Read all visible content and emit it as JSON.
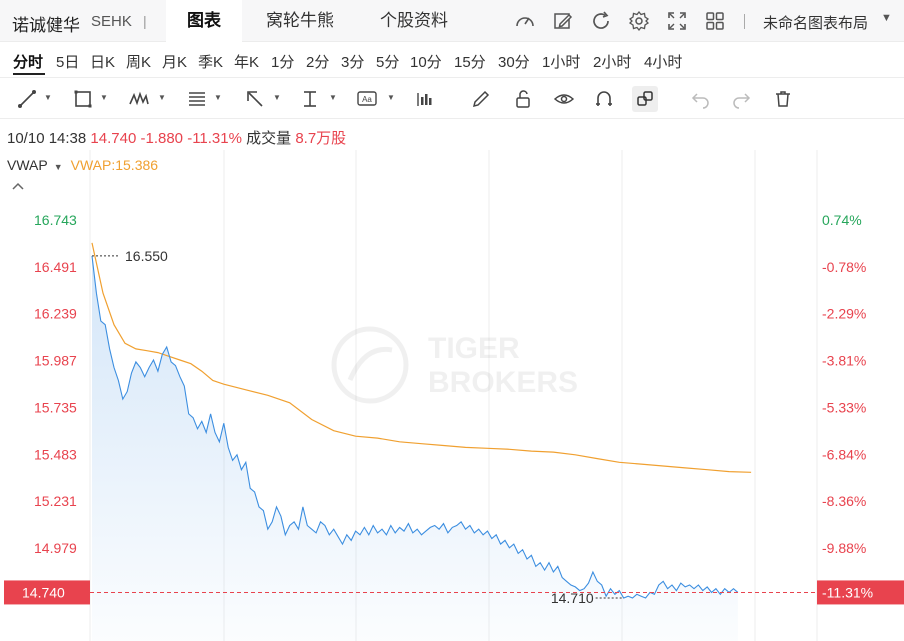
{
  "header": {
    "stock_name": "诺诚健华",
    "market": "SEHK",
    "separator": "|",
    "tabs": [
      {
        "label": "图表",
        "active": true
      },
      {
        "label": "窝轮牛熊",
        "active": false
      },
      {
        "label": "个股资料",
        "active": false
      }
    ],
    "icons": [
      "gauge-icon",
      "pen-edit-icon",
      "refresh-icon",
      "gear-icon",
      "fullscreen-icon",
      "grid-layout-icon"
    ],
    "layout_label": "未命名图表布局",
    "layout_caret": "▼"
  },
  "periods": {
    "items": [
      "分时",
      "5日",
      "日K",
      "周K",
      "月K",
      "季K",
      "年K",
      "1分",
      "2分",
      "3分",
      "5分",
      "10分",
      "15分",
      "30分",
      "1小时",
      "2小时",
      "4小时"
    ],
    "active_index": 0
  },
  "tools": {
    "icons": [
      "trend-line-icon",
      "rectangle-icon",
      "wave-pattern-icon",
      "fib-lines-icon",
      "arrow-icon",
      "measure-icon",
      "text-label-icon",
      "bar-chart-icon",
      "pencil-icon",
      "unlock-icon",
      "eye-icon",
      "magnet-icon",
      "link-icon",
      "undo-icon",
      "redo-icon",
      "trash-icon"
    ]
  },
  "info": {
    "datetime": "10/10 14:38",
    "price": "14.740",
    "change": "-1.880",
    "change_pct": "-11.31%",
    "volume_label": "成交量",
    "volume": "8.7万股"
  },
  "vwap": {
    "name": "VWAP",
    "caret": "▼",
    "value_label": "VWAP:15.386"
  },
  "watermark": {
    "line1": "TIGER",
    "line2": "BROKERS"
  },
  "colors": {
    "up": "#26a65b",
    "down": "#e8434e",
    "price_line": "#3c8ee0",
    "vwap_line": "#f0a030",
    "last_price_tag": "#e8434e"
  },
  "chart_data": {
    "type": "line",
    "prev_close": 16.62,
    "last_price": 14.74,
    "high_marker": "16.550",
    "low_marker": "14.710",
    "price_tag": "14.740",
    "pct_tag": "-11.31%",
    "yticks_left": [
      "16.743",
      "16.491",
      "16.239",
      "15.987",
      "15.735",
      "15.483",
      "15.231",
      "14.979"
    ],
    "yticks_right": [
      "0.74%",
      "-0.78%",
      "-2.29%",
      "-3.81%",
      "-5.33%",
      "-6.84%",
      "-8.36%",
      "-9.88%"
    ],
    "ylim": [
      14.62,
      16.83
    ],
    "x_total_minutes": 330,
    "series": [
      {
        "name": "price",
        "x": [
          0,
          2,
          4,
          6,
          8,
          10,
          12,
          14,
          16,
          18,
          20,
          22,
          24,
          26,
          28,
          30,
          32,
          34,
          36,
          38,
          40,
          42,
          44,
          46,
          48,
          50,
          52,
          54,
          56,
          58,
          60,
          62,
          64,
          66,
          68,
          70,
          72,
          74,
          76,
          78,
          80,
          82,
          84,
          86,
          88,
          90,
          92,
          94,
          96,
          98,
          100,
          102,
          104,
          106,
          108,
          110,
          112,
          114,
          116,
          118,
          120,
          122,
          124,
          126,
          128,
          130,
          132,
          134,
          136,
          138,
          140,
          142,
          144,
          146,
          148,
          150,
          152,
          154,
          156,
          158,
          160,
          162,
          164,
          166,
          168,
          170,
          172,
          174,
          176,
          178,
          180,
          182,
          184,
          186,
          188,
          190,
          192,
          194,
          196,
          198,
          200,
          202,
          204,
          206,
          208,
          210,
          212,
          214,
          216,
          218,
          220,
          222,
          224,
          226,
          228,
          230,
          232,
          234,
          236,
          238,
          240,
          242,
          244,
          246,
          248,
          250,
          252,
          254,
          256,
          258,
          260,
          262,
          264,
          266,
          268,
          270,
          272,
          274,
          276,
          278,
          280,
          282,
          284,
          286,
          288,
          290,
          292,
          294
        ],
        "values": [
          16.55,
          16.35,
          16.2,
          16.18,
          16.05,
          15.95,
          15.88,
          15.78,
          15.82,
          15.92,
          15.98,
          15.95,
          15.9,
          15.95,
          15.99,
          15.93,
          16.02,
          16.06,
          15.98,
          15.96,
          15.9,
          15.85,
          15.7,
          15.68,
          15.62,
          15.66,
          15.6,
          15.7,
          15.6,
          15.55,
          15.65,
          15.52,
          15.45,
          15.48,
          15.4,
          15.44,
          15.3,
          15.28,
          15.2,
          15.18,
          15.08,
          15.12,
          15.2,
          15.15,
          15.05,
          15.1,
          15.12,
          15.08,
          15.2,
          15.1,
          15.08,
          15.06,
          15.12,
          15.1,
          15.05,
          15.08,
          15.04,
          15.0,
          15.05,
          15.02,
          15.07,
          15.05,
          15.09,
          15.05,
          15.1,
          15.06,
          15.08,
          15.05,
          15.1,
          15.06,
          15.09,
          15.07,
          15.11,
          15.06,
          15.08,
          15.05,
          15.07,
          15.09,
          15.1,
          15.08,
          15.11,
          15.06,
          15.09,
          15.1,
          15.12,
          15.08,
          15.1,
          15.06,
          15.08,
          15.05,
          15.07,
          15.03,
          15.05,
          15.0,
          15.02,
          14.98,
          15.0,
          14.95,
          14.97,
          14.92,
          14.94,
          14.88,
          14.9,
          14.86,
          14.9,
          14.85,
          14.88,
          14.82,
          14.8,
          14.78,
          14.77,
          14.75,
          14.76,
          14.79,
          14.85,
          14.8,
          14.78,
          14.72,
          14.76,
          14.73,
          14.75,
          14.71,
          14.72,
          14.71,
          14.73,
          14.72,
          14.71,
          14.74,
          14.73,
          14.78,
          14.8,
          14.76,
          14.78,
          14.75,
          14.79,
          14.77,
          14.78,
          14.76,
          14.78,
          14.75,
          14.77,
          14.74,
          14.76,
          14.73,
          14.76,
          14.74,
          14.76,
          14.74
        ]
      },
      {
        "name": "VWAP",
        "x": [
          0,
          5,
          10,
          15,
          20,
          25,
          30,
          35,
          40,
          45,
          50,
          55,
          60,
          70,
          80,
          90,
          100,
          110,
          120,
          130,
          140,
          150,
          160,
          170,
          180,
          190,
          200,
          210,
          220,
          230,
          240,
          250,
          260,
          270,
          280,
          290,
          300
        ],
        "values": [
          16.62,
          16.35,
          16.18,
          16.08,
          16.05,
          16.04,
          16.03,
          16.01,
          15.99,
          15.97,
          15.93,
          15.88,
          15.86,
          15.83,
          15.8,
          15.76,
          15.67,
          15.61,
          15.58,
          15.57,
          15.55,
          15.54,
          15.53,
          15.52,
          15.515,
          15.51,
          15.5,
          15.495,
          15.48,
          15.46,
          15.44,
          15.43,
          15.42,
          15.41,
          15.4,
          15.39,
          15.386
        ]
      }
    ]
  }
}
